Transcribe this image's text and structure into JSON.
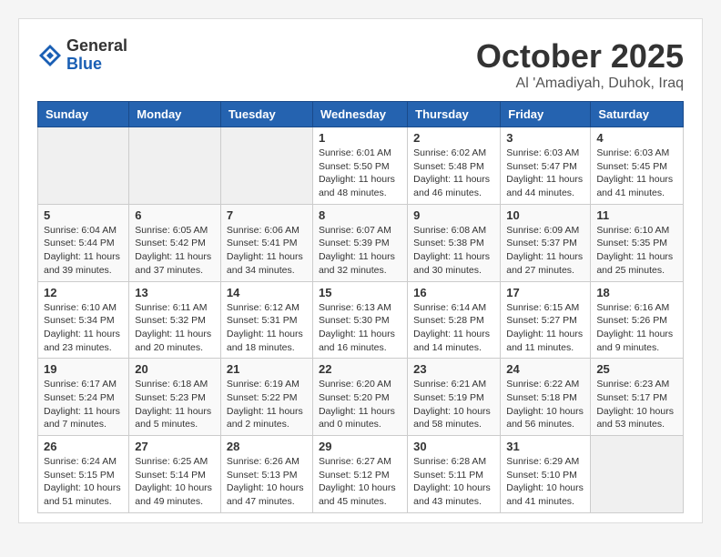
{
  "header": {
    "logo_general": "General",
    "logo_blue": "Blue",
    "month_title": "October 2025",
    "location": "Al 'Amadiyah, Duhok, Iraq"
  },
  "weekdays": [
    "Sunday",
    "Monday",
    "Tuesday",
    "Wednesday",
    "Thursday",
    "Friday",
    "Saturday"
  ],
  "weeks": [
    [
      {
        "day": "",
        "info": ""
      },
      {
        "day": "",
        "info": ""
      },
      {
        "day": "",
        "info": ""
      },
      {
        "day": "1",
        "info": "Sunrise: 6:01 AM\nSunset: 5:50 PM\nDaylight: 11 hours and 48 minutes."
      },
      {
        "day": "2",
        "info": "Sunrise: 6:02 AM\nSunset: 5:48 PM\nDaylight: 11 hours and 46 minutes."
      },
      {
        "day": "3",
        "info": "Sunrise: 6:03 AM\nSunset: 5:47 PM\nDaylight: 11 hours and 44 minutes."
      },
      {
        "day": "4",
        "info": "Sunrise: 6:03 AM\nSunset: 5:45 PM\nDaylight: 11 hours and 41 minutes."
      }
    ],
    [
      {
        "day": "5",
        "info": "Sunrise: 6:04 AM\nSunset: 5:44 PM\nDaylight: 11 hours and 39 minutes."
      },
      {
        "day": "6",
        "info": "Sunrise: 6:05 AM\nSunset: 5:42 PM\nDaylight: 11 hours and 37 minutes."
      },
      {
        "day": "7",
        "info": "Sunrise: 6:06 AM\nSunset: 5:41 PM\nDaylight: 11 hours and 34 minutes."
      },
      {
        "day": "8",
        "info": "Sunrise: 6:07 AM\nSunset: 5:39 PM\nDaylight: 11 hours and 32 minutes."
      },
      {
        "day": "9",
        "info": "Sunrise: 6:08 AM\nSunset: 5:38 PM\nDaylight: 11 hours and 30 minutes."
      },
      {
        "day": "10",
        "info": "Sunrise: 6:09 AM\nSunset: 5:37 PM\nDaylight: 11 hours and 27 minutes."
      },
      {
        "day": "11",
        "info": "Sunrise: 6:10 AM\nSunset: 5:35 PM\nDaylight: 11 hours and 25 minutes."
      }
    ],
    [
      {
        "day": "12",
        "info": "Sunrise: 6:10 AM\nSunset: 5:34 PM\nDaylight: 11 hours and 23 minutes."
      },
      {
        "day": "13",
        "info": "Sunrise: 6:11 AM\nSunset: 5:32 PM\nDaylight: 11 hours and 20 minutes."
      },
      {
        "day": "14",
        "info": "Sunrise: 6:12 AM\nSunset: 5:31 PM\nDaylight: 11 hours and 18 minutes."
      },
      {
        "day": "15",
        "info": "Sunrise: 6:13 AM\nSunset: 5:30 PM\nDaylight: 11 hours and 16 minutes."
      },
      {
        "day": "16",
        "info": "Sunrise: 6:14 AM\nSunset: 5:28 PM\nDaylight: 11 hours and 14 minutes."
      },
      {
        "day": "17",
        "info": "Sunrise: 6:15 AM\nSunset: 5:27 PM\nDaylight: 11 hours and 11 minutes."
      },
      {
        "day": "18",
        "info": "Sunrise: 6:16 AM\nSunset: 5:26 PM\nDaylight: 11 hours and 9 minutes."
      }
    ],
    [
      {
        "day": "19",
        "info": "Sunrise: 6:17 AM\nSunset: 5:24 PM\nDaylight: 11 hours and 7 minutes."
      },
      {
        "day": "20",
        "info": "Sunrise: 6:18 AM\nSunset: 5:23 PM\nDaylight: 11 hours and 5 minutes."
      },
      {
        "day": "21",
        "info": "Sunrise: 6:19 AM\nSunset: 5:22 PM\nDaylight: 11 hours and 2 minutes."
      },
      {
        "day": "22",
        "info": "Sunrise: 6:20 AM\nSunset: 5:20 PM\nDaylight: 11 hours and 0 minutes."
      },
      {
        "day": "23",
        "info": "Sunrise: 6:21 AM\nSunset: 5:19 PM\nDaylight: 10 hours and 58 minutes."
      },
      {
        "day": "24",
        "info": "Sunrise: 6:22 AM\nSunset: 5:18 PM\nDaylight: 10 hours and 56 minutes."
      },
      {
        "day": "25",
        "info": "Sunrise: 6:23 AM\nSunset: 5:17 PM\nDaylight: 10 hours and 53 minutes."
      }
    ],
    [
      {
        "day": "26",
        "info": "Sunrise: 6:24 AM\nSunset: 5:15 PM\nDaylight: 10 hours and 51 minutes."
      },
      {
        "day": "27",
        "info": "Sunrise: 6:25 AM\nSunset: 5:14 PM\nDaylight: 10 hours and 49 minutes."
      },
      {
        "day": "28",
        "info": "Sunrise: 6:26 AM\nSunset: 5:13 PM\nDaylight: 10 hours and 47 minutes."
      },
      {
        "day": "29",
        "info": "Sunrise: 6:27 AM\nSunset: 5:12 PM\nDaylight: 10 hours and 45 minutes."
      },
      {
        "day": "30",
        "info": "Sunrise: 6:28 AM\nSunset: 5:11 PM\nDaylight: 10 hours and 43 minutes."
      },
      {
        "day": "31",
        "info": "Sunrise: 6:29 AM\nSunset: 5:10 PM\nDaylight: 10 hours and 41 minutes."
      },
      {
        "day": "",
        "info": ""
      }
    ]
  ]
}
